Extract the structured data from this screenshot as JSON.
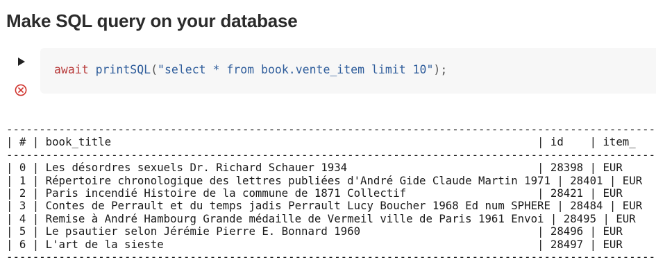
{
  "section": {
    "title": "Make SQL query on your database"
  },
  "cell": {
    "run_icon": "play-icon",
    "status_icon": "error-circle-x-icon",
    "code": {
      "keyword": "await",
      "function": "printSQL",
      "open": "(",
      "string": "\"select * from book.vente_item limit 10\"",
      "close": ");"
    }
  },
  "output": {
    "lines": [
      "--------------------------------------------------------------------------------------------------------------------------",
      "| # | book_title                                                                 | id    | item_",
      "--------------------------------------------------------------------------------------------------------------------------",
      "| 0 | Les désordres sexuels Dr. Richard Schauer 1934                             | 28398 | EUR",
      "| 1 | Répertoire chronologique des lettres publiées d'André Gide Claude Martin 1971 | 28401 | EUR",
      "| 2 | Paris incendié Histoire de la commune de 1871 Collectif                    | 28421 | EUR",
      "| 3 | Contes de Perrault et du temps jadis Perrault Lucy Boucher 1968 Ed num SPHERE | 28484 | EUR",
      "| 4 | Remise à André Hambourg Grande médaille de Vermeil ville de Paris 1961 Envoi | 28495 | EUR",
      "| 5 | Le psautier selon Jérémie Pierre E. Bonnard 1960                           | 28496 | EUR",
      "| 6 | L'art de la sieste                                                         | 28497 | EUR",
      "--------------------------------------------------------------------------------------------------------------------------"
    ]
  },
  "colors": {
    "keyword": "#b83a3a",
    "function": "#2f5d9b",
    "string": "#2f5d9b",
    "error": "#d0322c",
    "cell_background": "#f7f7f7"
  }
}
